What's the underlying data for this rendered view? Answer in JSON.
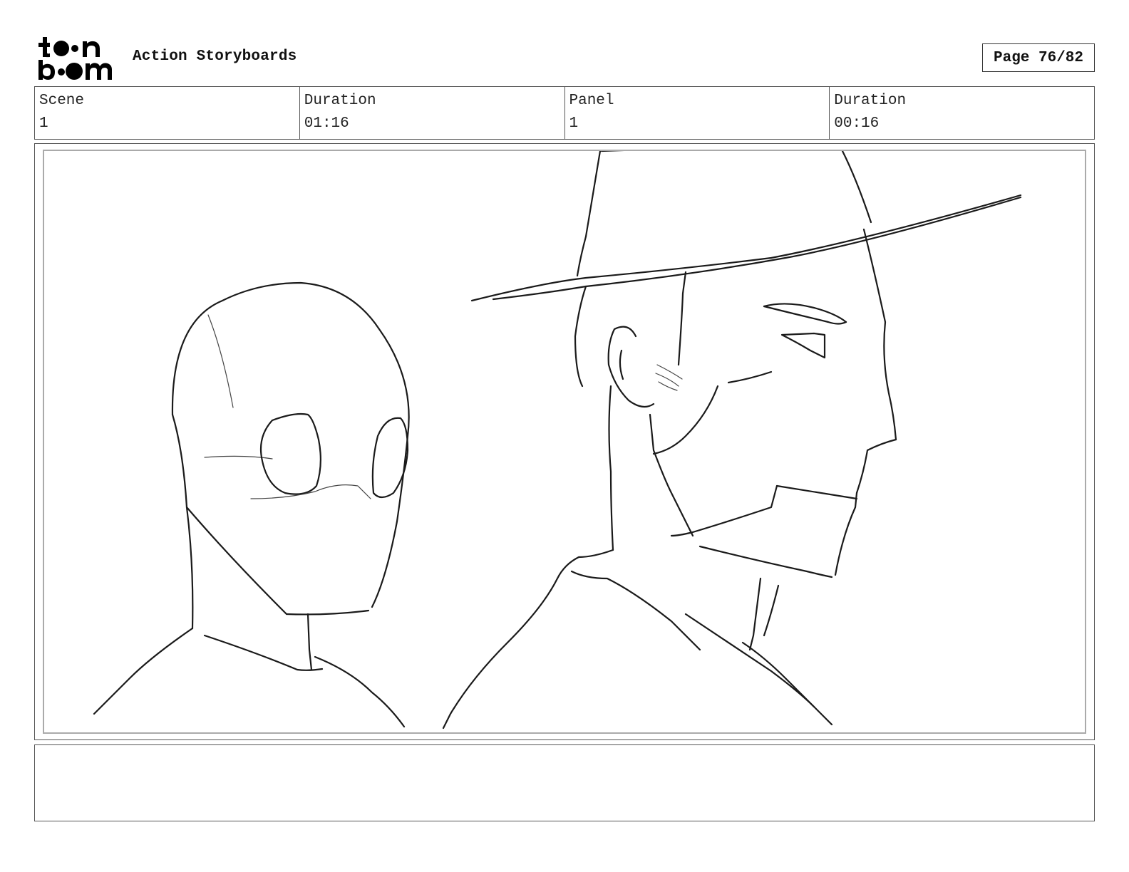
{
  "header": {
    "logo_text": "toon boom",
    "title": "Action Storyboards",
    "page_label": "Page 76/82"
  },
  "info": {
    "scene_label": "Scene",
    "scene_value": "1",
    "scene_duration_label": "Duration",
    "scene_duration_value": "01:16",
    "panel_label": "Panel",
    "panel_value": "1",
    "panel_duration_label": "Duration",
    "panel_duration_value": "00:16"
  },
  "notes": {
    "text": ""
  }
}
